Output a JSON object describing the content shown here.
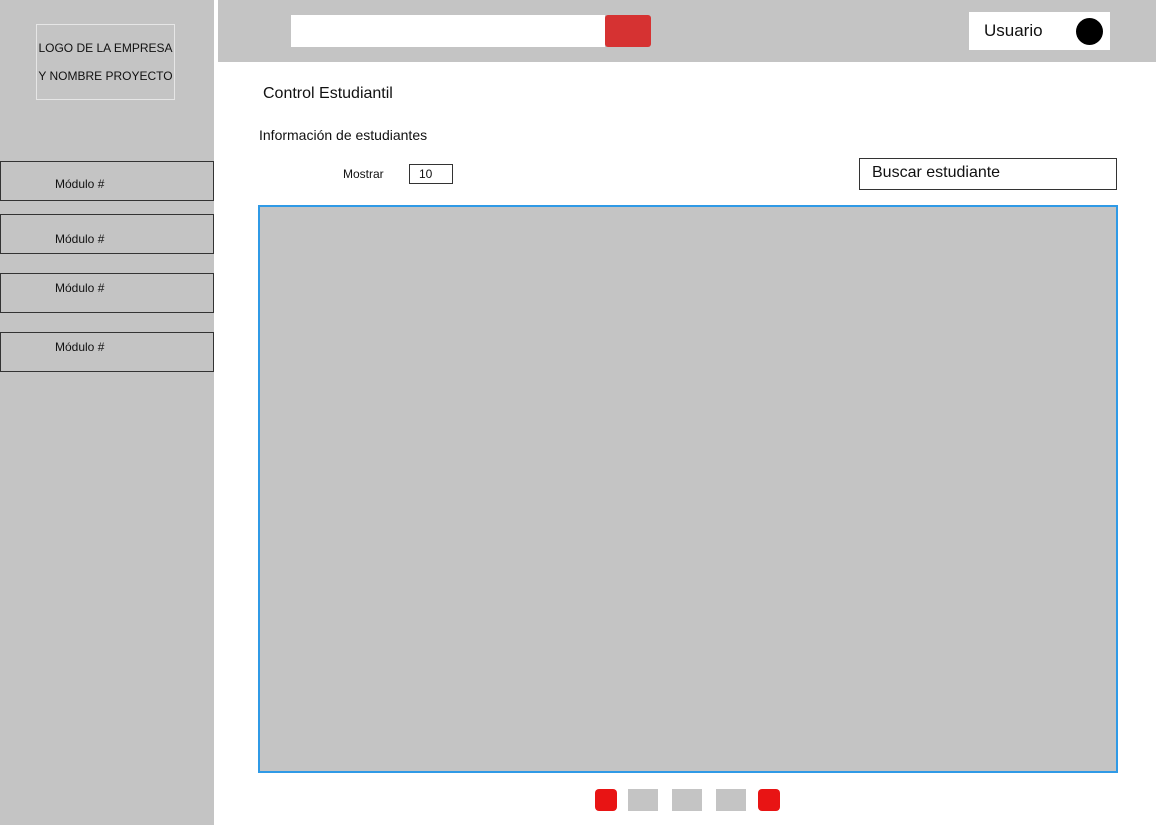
{
  "sidebar": {
    "logo_line1": "LOGO DE LA EMPRESA",
    "logo_line2": "Y NOMBRE PROYECTO",
    "items": [
      {
        "label": "Módulo #"
      },
      {
        "label": "Módulo #"
      },
      {
        "label": "Módulo #"
      },
      {
        "label": "Módulo #"
      }
    ]
  },
  "header": {
    "search_value": "",
    "user_label": "Usuario"
  },
  "main": {
    "page_title": "Control Estudiantil",
    "section_title": "Información de estudiantes",
    "show_label": "Mostrar",
    "show_value": "10",
    "search_placeholder": "Buscar estudiante"
  },
  "pagination": {
    "buttons": [
      "prev",
      "page",
      "page",
      "page",
      "next"
    ]
  },
  "colors": {
    "panel_grey": "#c4c4c4",
    "accent_red": "#d63232",
    "pager_red": "#e81414",
    "table_border_blue": "#2f9ae6"
  }
}
